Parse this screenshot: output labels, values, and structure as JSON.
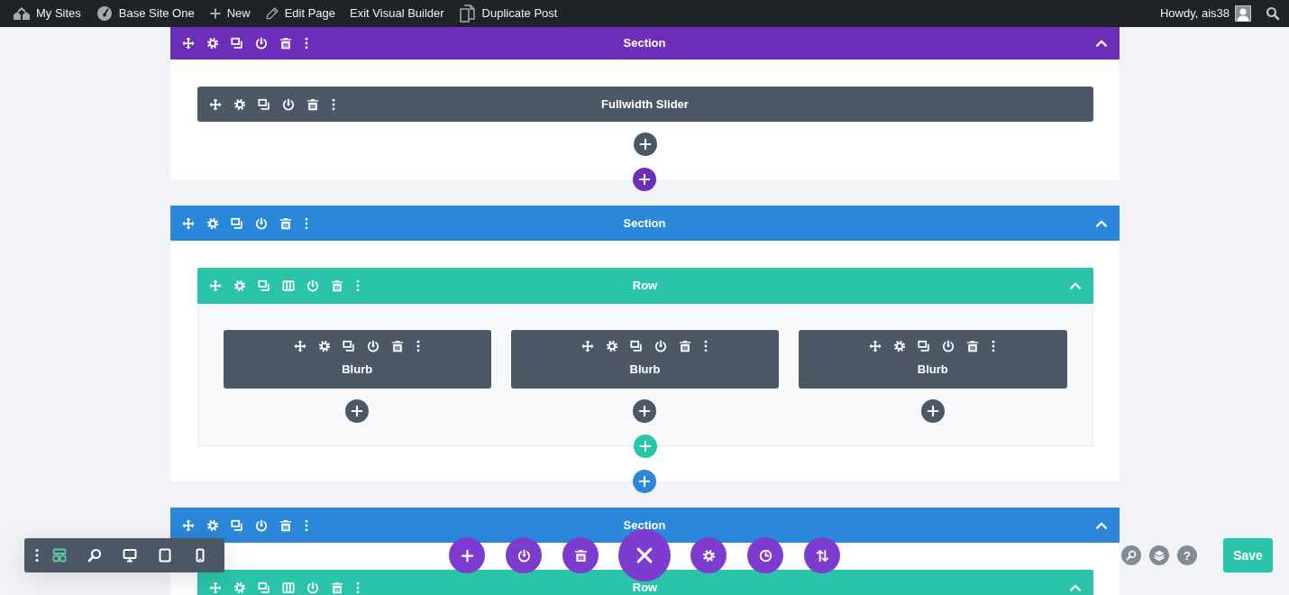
{
  "admin_bar": {
    "items": [
      {
        "kind": "sites",
        "label": "My Sites"
      },
      {
        "kind": "dashboard",
        "label": "Base Site One"
      },
      {
        "kind": "new",
        "label": "New"
      },
      {
        "kind": "edit",
        "label": "Edit Page"
      },
      {
        "kind": "plain",
        "label": "Exit Visual Builder"
      },
      {
        "kind": "duplicate",
        "label": "Duplicate Post"
      }
    ],
    "greeting": "Howdy, ais38"
  },
  "sections": [
    {
      "title": "Section",
      "color": "#6c2eb9",
      "expanded": true,
      "add_button": true,
      "modules": [
        {
          "title": "Fullwidth Slider"
        }
      ]
    },
    {
      "title": "Section",
      "color": "#2b87da",
      "expanded": true,
      "add_button": true,
      "rows": [
        {
          "title": "Row",
          "expanded": true,
          "columns": [
            {
              "modules": [
                {
                  "title": "Blurb"
                }
              ]
            },
            {
              "modules": [
                {
                  "title": "Blurb"
                }
              ]
            },
            {
              "modules": [
                {
                  "title": "Blurb"
                }
              ]
            }
          ]
        }
      ]
    },
    {
      "title": "Section",
      "color": "#2b87da",
      "expanded": true,
      "add_button": false,
      "rows": [
        {
          "title": "Row",
          "expanded": true
        }
      ]
    }
  ],
  "view_modes": [
    {
      "kind": "wireframe",
      "selected": true
    },
    {
      "kind": "zoom",
      "selected": false
    },
    {
      "kind": "desktop",
      "selected": false
    },
    {
      "kind": "tablet",
      "selected": false
    },
    {
      "kind": "phone",
      "selected": false
    }
  ],
  "actions": [
    {
      "kind": "add"
    },
    {
      "kind": "disable"
    },
    {
      "kind": "delete"
    },
    {
      "kind": "close"
    },
    {
      "kind": "settings"
    },
    {
      "kind": "history"
    },
    {
      "kind": "portability"
    }
  ],
  "help_label": "?",
  "save_label": "Save"
}
